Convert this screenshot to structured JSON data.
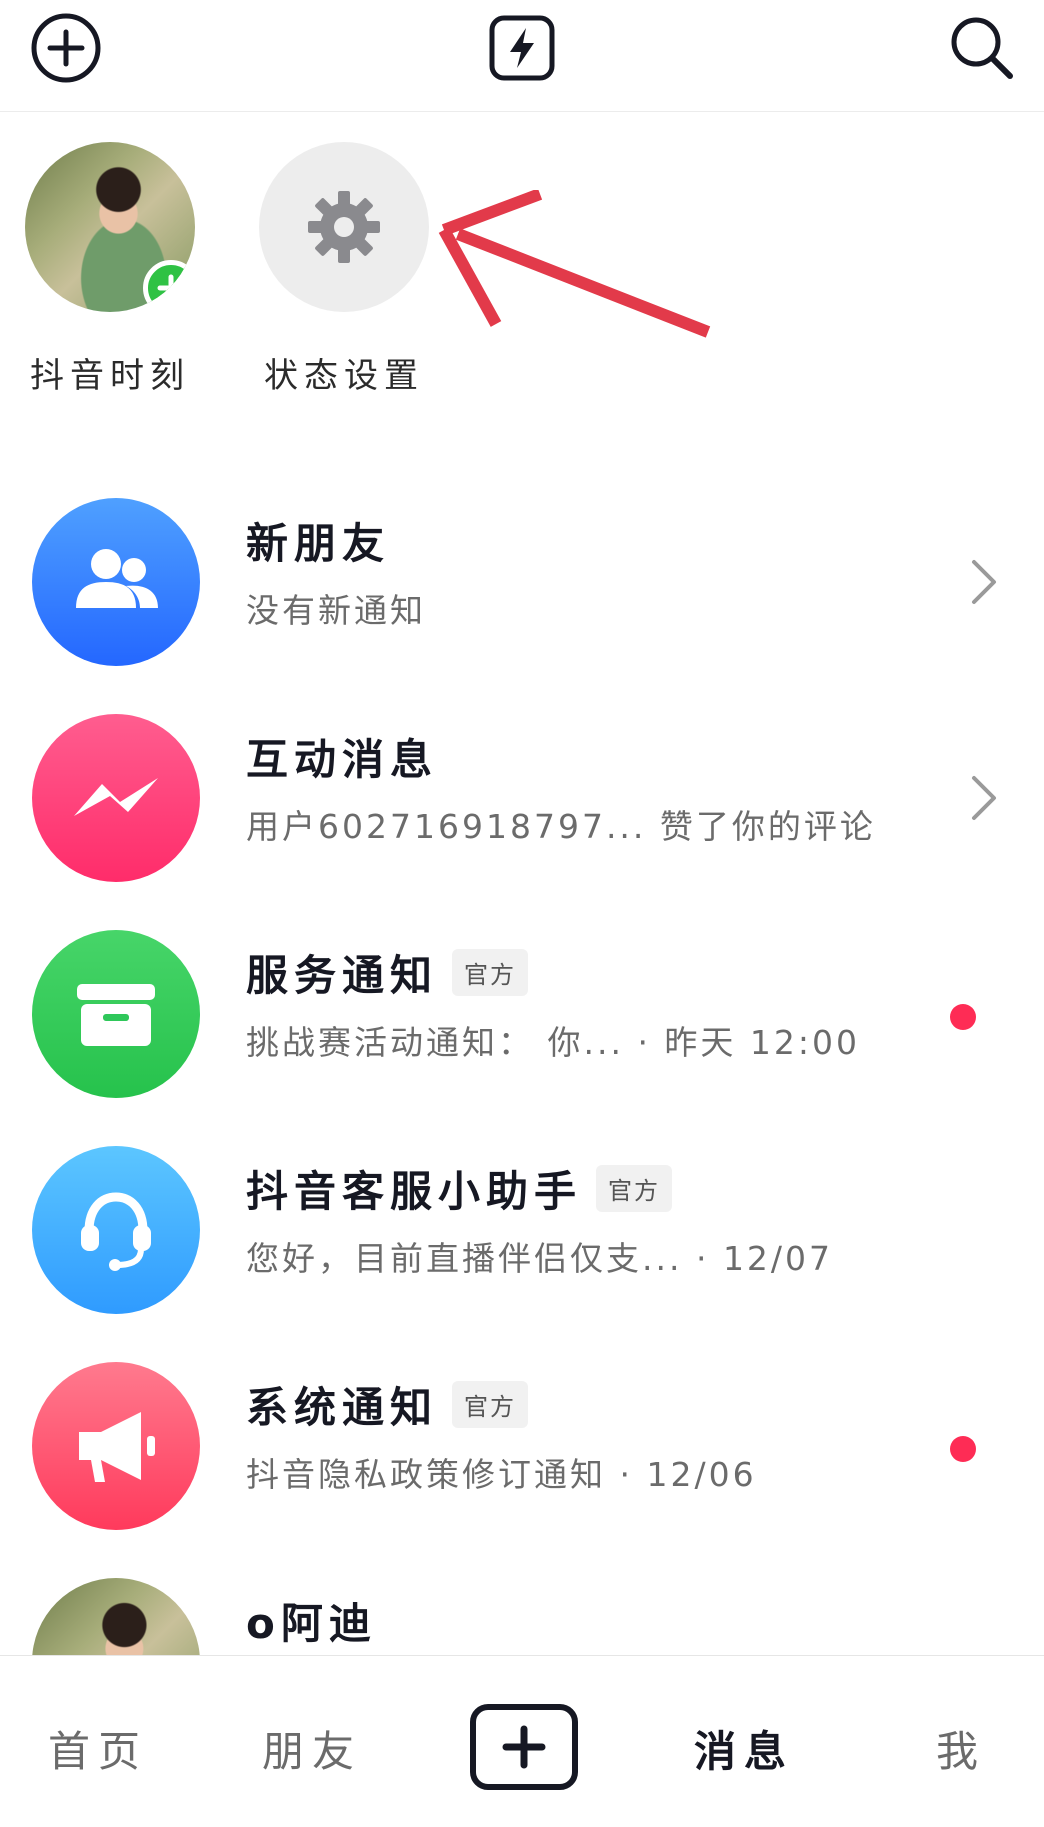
{
  "topbar": {
    "left_icon": "plus-circle-icon",
    "center_icon": "lightning-icon",
    "right_icon": "search-icon"
  },
  "stories": [
    {
      "label": "抖音时刻",
      "icon": "avatar-photo"
    },
    {
      "label": "状态设置",
      "icon": "gear-icon"
    }
  ],
  "list": [
    {
      "title": "新朋友",
      "subtitle": "没有新通知",
      "tag": "",
      "icon": "friends-icon",
      "color": "#2f74ff",
      "trailing": "chevron"
    },
    {
      "title": "互动消息",
      "subtitle": "用户602716918797... 赞了你的评论",
      "tag": "",
      "icon": "interaction-icon",
      "color": "#ff3a74",
      "trailing": "chevron"
    },
    {
      "title": "服务通知",
      "subtitle": "挑战赛活动通知： 你... · 昨天 12:00",
      "tag": "官方",
      "icon": "inbox-icon",
      "color": "#2fc75a",
      "trailing": "dot"
    },
    {
      "title": "抖音客服小助手",
      "subtitle": "您好，目前直播伴侣仅支... · 12/07",
      "tag": "官方",
      "icon": "headset-icon",
      "color": "#3ea6ff",
      "trailing": "none"
    },
    {
      "title": "系统通知",
      "subtitle": "抖音隐私政策修订通知 · 12/06",
      "tag": "官方",
      "icon": "megaphone-icon",
      "color": "#ff4f6a",
      "trailing": "dot"
    },
    {
      "title": "o阿迪",
      "subtitle": "",
      "tag": "",
      "icon": "avatar-photo",
      "color": "",
      "trailing": "none"
    }
  ],
  "nav": {
    "home": "首页",
    "friends": "朋友",
    "messages": "消息",
    "me": "我"
  },
  "colors": {
    "accent_red": "#fe2c55",
    "arrow_red": "#e23a4a"
  }
}
